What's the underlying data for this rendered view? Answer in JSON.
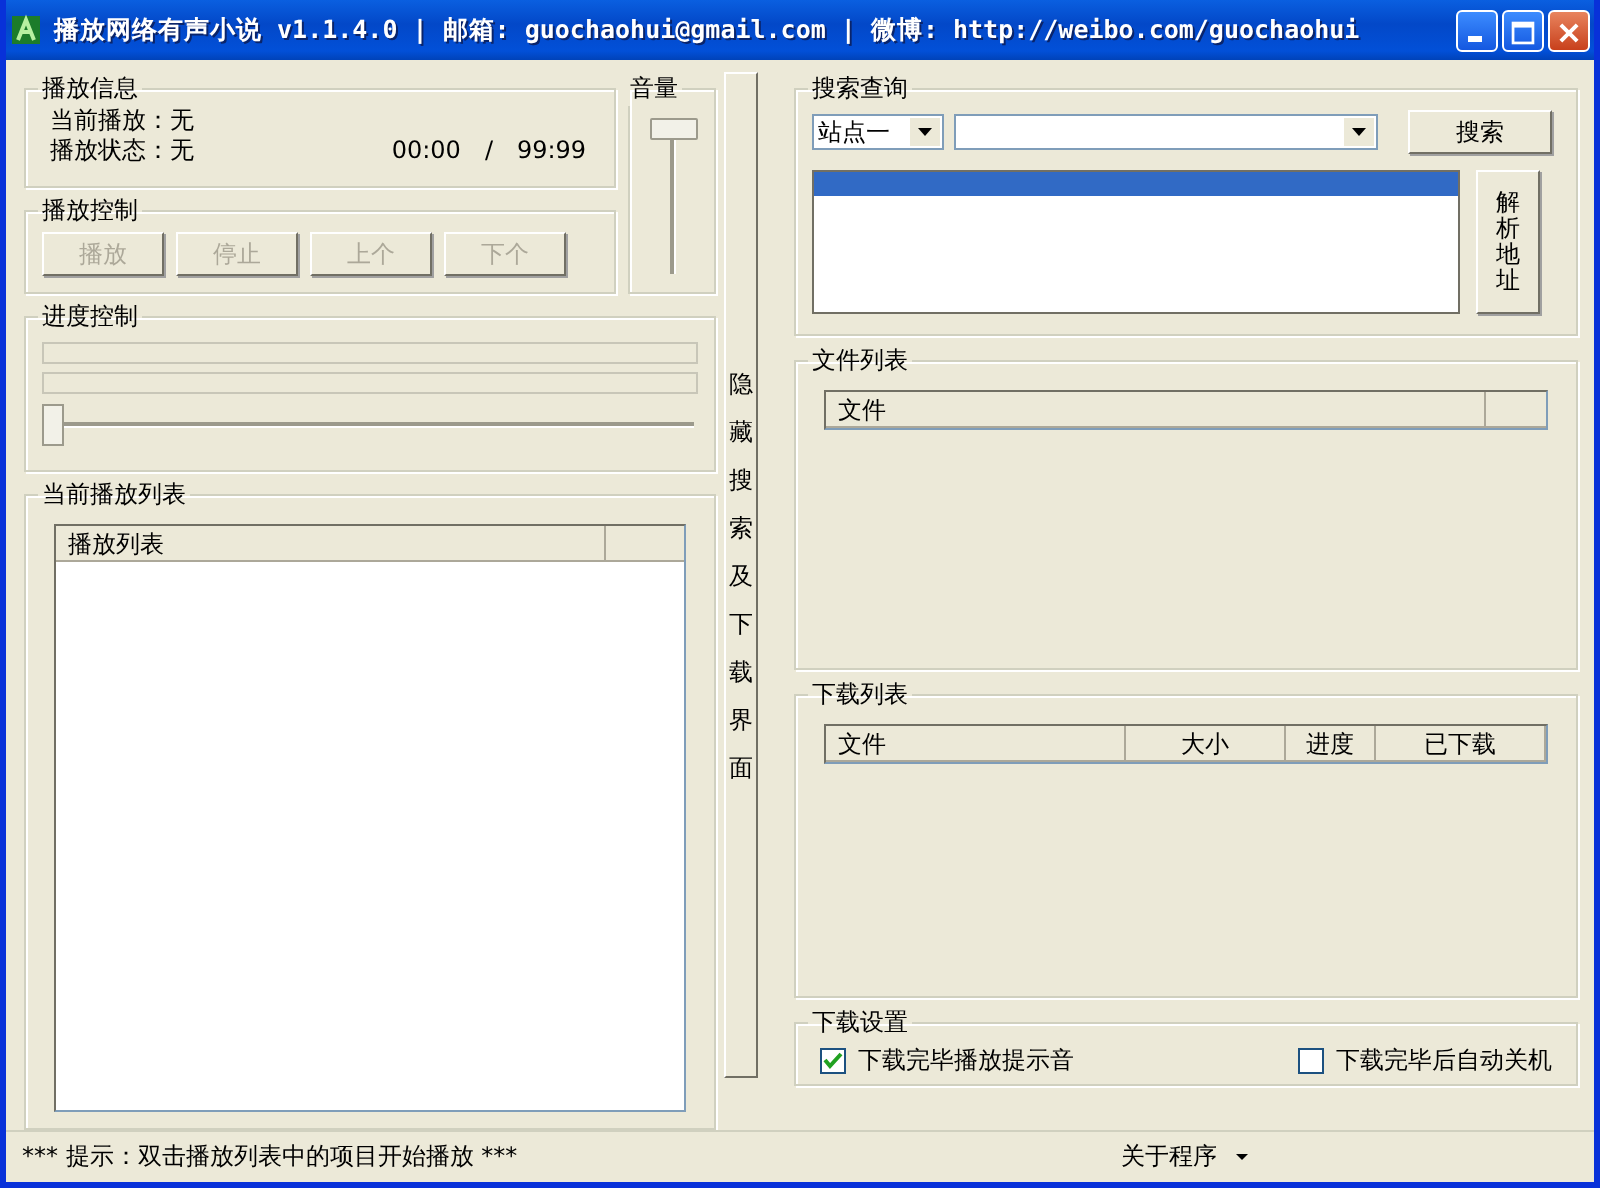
{
  "window": {
    "title": "播放网络有声小说 v1.1.4.0 | 邮箱: guochaohui@gmail.com | 微博: http://weibo.com/guochaohui"
  },
  "playback_info": {
    "title": "播放信息",
    "current": "当前播放：无",
    "status": "播放状态：无",
    "elapsed": "00:00",
    "separator": "/",
    "total": "99:99"
  },
  "playback_control": {
    "title": "播放控制",
    "buttons": [
      {
        "label": "播放",
        "disabled": true
      },
      {
        "label": "停止",
        "disabled": true
      },
      {
        "label": "上个",
        "disabled": true
      },
      {
        "label": "下个",
        "disabled": true
      }
    ]
  },
  "volume": {
    "title": "音量",
    "level": 1
  },
  "progress": {
    "title": "进度控制",
    "bars": [
      {
        "level": 0
      },
      {
        "level": 0
      }
    ],
    "slider": {
      "level": 0
    }
  },
  "playlist": {
    "title": "当前播放列表",
    "columns": [
      "播放列表"
    ]
  },
  "splitter_button": {
    "label": "隐藏搜索及下载界面"
  },
  "search": {
    "title": "搜索查询",
    "site": "站点一",
    "button": "搜索",
    "results": [
      {
        "selected": true
      }
    ],
    "parse_button": "解析地址"
  },
  "file_list": {
    "title": "文件列表",
    "columns": [
      "文件"
    ]
  },
  "download_list": {
    "title": "下载列表",
    "columns": [
      "文件",
      "大小",
      "进度",
      "已下载"
    ]
  },
  "download_settings": {
    "title": "下载设置",
    "options": [
      {
        "label": "下载完毕播放提示音",
        "checked": true
      },
      {
        "label": "下载完毕后自动关机",
        "checked": false
      }
    ]
  },
  "status_bar": {
    "hint": "*** 提示：双击播放列表中的项目开始播放 ***",
    "menu": "关于程序"
  }
}
